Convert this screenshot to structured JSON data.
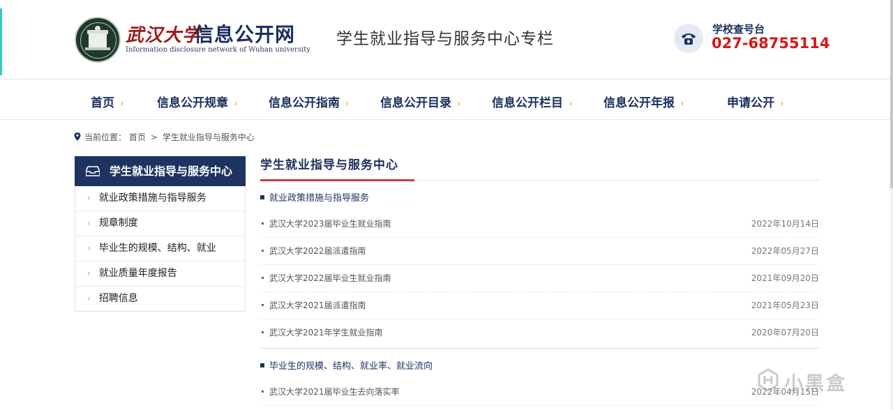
{
  "header": {
    "university_name": "武汉大学",
    "site_name": "信息公开网",
    "site_name_en": "Information disclosure network of Wuhan university",
    "column_title": "学生就业指导与服务中心专栏",
    "phone_label": "学校查号台",
    "phone_number": "027-68755114",
    "phone_icon": "telephone-icon"
  },
  "nav": {
    "items": [
      {
        "label": "首页"
      },
      {
        "label": "信息公开规章"
      },
      {
        "label": "信息公开指南"
      },
      {
        "label": "信息公开目录"
      },
      {
        "label": "信息公开栏目"
      },
      {
        "label": "信息公开年报"
      },
      {
        "label": "申请公开"
      }
    ],
    "chevron": "›"
  },
  "breadcrumb": {
    "prefix": "当前位置：",
    "items": [
      "首页",
      "学生就业指导与服务中心"
    ],
    "separator": ">"
  },
  "sidebar": {
    "title": "学生就业指导与服务中心",
    "chevron": "›",
    "items": [
      {
        "label": "就业政策措施与指导服务"
      },
      {
        "label": "规章制度"
      },
      {
        "label": "毕业生的规模、结构、就业"
      },
      {
        "label": "就业质量年度报告"
      },
      {
        "label": "招聘信息"
      }
    ]
  },
  "main": {
    "title": "学生就业指导与服务中心",
    "sections": [
      {
        "heading": "就业政策措施与指导服务",
        "items": [
          {
            "title": "武汉大学2023届毕业生就业指南",
            "date": "2022年10月14日"
          },
          {
            "title": "武汉大学2022届派遣指南",
            "date": "2022年05月27日"
          },
          {
            "title": "武汉大学2022届毕业生就业指南",
            "date": "2021年09月20日"
          },
          {
            "title": "武汉大学2021届派遣指南",
            "date": "2021年05月23日"
          },
          {
            "title": "武汉大学2021年学生就业指南",
            "date": "2020年07月20日"
          }
        ]
      },
      {
        "heading": "毕业生的规模、结构、就业率、就业流向",
        "items": [
          {
            "title": "武汉大学2021届毕业生去向落实率",
            "date": "2022年04月15日"
          }
        ]
      }
    ]
  },
  "watermark": {
    "text": "小黑盒"
  },
  "colors": {
    "navy": "#1b2f5d",
    "accent_red": "#c93b45",
    "phone_red": "#d61919",
    "chevron_gold": "#e1a93b"
  }
}
